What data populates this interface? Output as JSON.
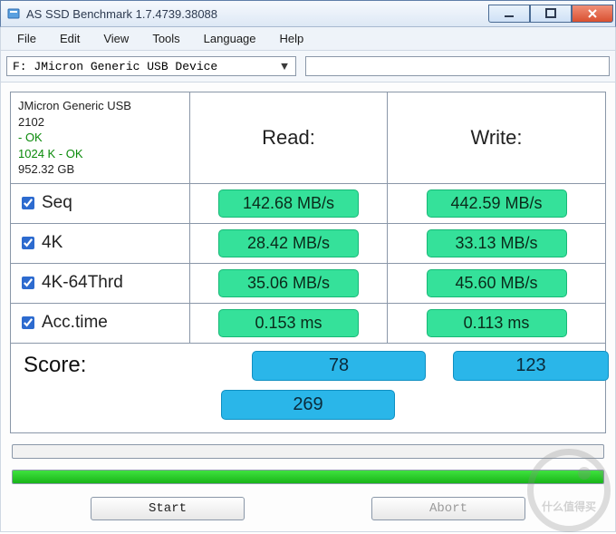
{
  "titlebar": {
    "title": "AS SSD Benchmark 1.7.4739.38088"
  },
  "menu": {
    "file": "File",
    "edit": "Edit",
    "view": "View",
    "tools": "Tools",
    "language": "Language",
    "help": "Help"
  },
  "drive": {
    "selected": "F: JMicron Generic USB Device"
  },
  "headers": {
    "read": "Read:",
    "write": "Write:"
  },
  "device": {
    "name": "JMicron Generic USB",
    "model": "2102",
    "status1": " - OK",
    "status2": "1024 K - OK",
    "capacity": "952.32 GB"
  },
  "rows": {
    "seq": {
      "label": "Seq",
      "read": "142.68 MB/s",
      "write": "442.59 MB/s"
    },
    "k4": {
      "label": "4K",
      "read": "28.42 MB/s",
      "write": "33.13 MB/s"
    },
    "k464": {
      "label": "4K-64Thrd",
      "read": "35.06 MB/s",
      "write": "45.60 MB/s"
    },
    "acc": {
      "label": "Acc.time",
      "read": "0.153 ms",
      "write": "0.113 ms"
    }
  },
  "score": {
    "label": "Score:",
    "read": "78",
    "write": "123",
    "total": "269"
  },
  "buttons": {
    "start": "Start",
    "abort": "Abort"
  },
  "watermark": {
    "text": "什么值得买"
  }
}
